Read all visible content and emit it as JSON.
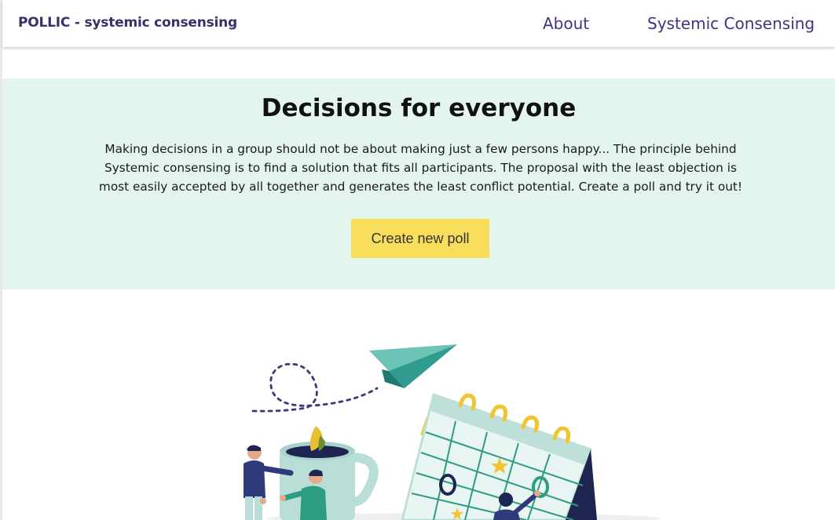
{
  "navbar": {
    "brand": "POLLIC - systemic consensing",
    "links": [
      {
        "label": "About"
      },
      {
        "label": "Systemic Consensing"
      }
    ]
  },
  "hero": {
    "title": "Decisions for everyone",
    "description": "Making decisions in a group should not be about making just a few persons happy... The principle behind Systemic consensing is to find a solution that fits all participants. The proposal with the least objection is most easily accepted by all together and generates the least conflict potential. Create a poll and try it out!",
    "button_label": "Create new poll"
  },
  "illustration": {
    "icon": "team-planning-illustration"
  },
  "colors": {
    "brand_text": "#38306b",
    "nav_link": "#4a2f7e",
    "hero_background": "#e4f5ee",
    "button_background": "#f9de5c"
  }
}
